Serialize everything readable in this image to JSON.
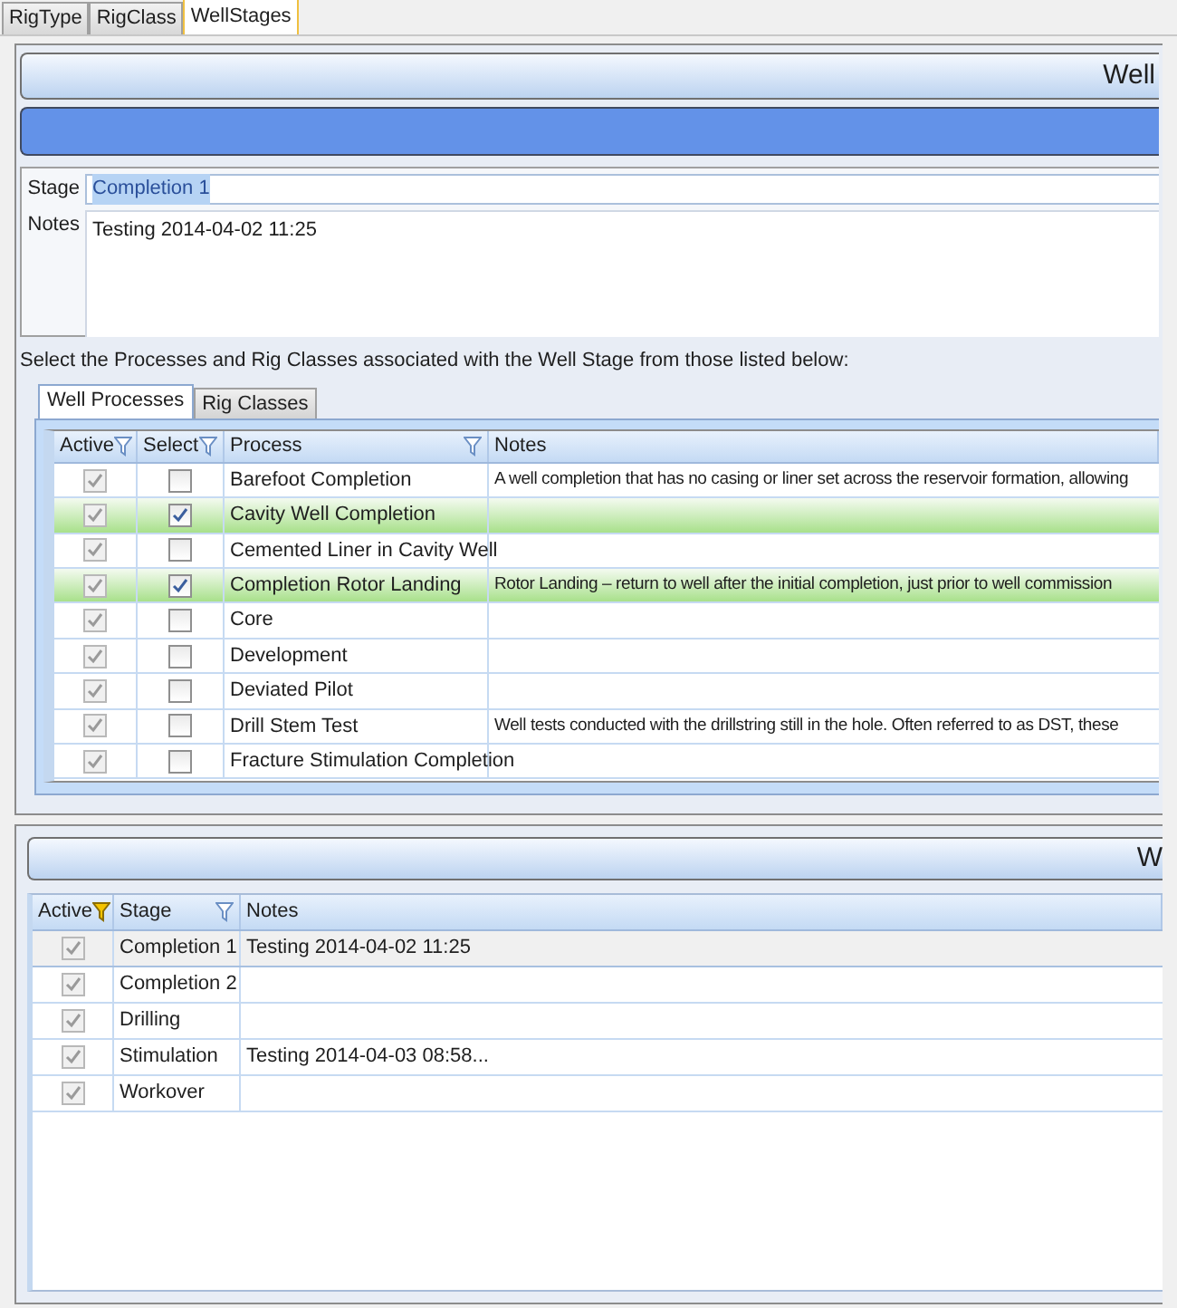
{
  "tabs": [
    {
      "label": "RigType",
      "selected": false
    },
    {
      "label": "RigClass",
      "selected": false
    },
    {
      "label": "WellStages",
      "selected": true
    }
  ],
  "header": {
    "title": "Well"
  },
  "stage_form": {
    "stage_label": "Stage",
    "stage_value": "Completion 1",
    "notes_label": "Notes",
    "notes_value": "Testing 2014-04-02 11:25"
  },
  "instruction": "Select the Processes and Rig Classes associated with the Well Stage from those listed below:",
  "inner_tabs": [
    {
      "label": "Well Processes",
      "selected": true
    },
    {
      "label": "Rig Classes",
      "selected": false
    }
  ],
  "process_grid": {
    "columns": [
      {
        "label": "Active",
        "filtered": false
      },
      {
        "label": "Select",
        "filtered": false
      },
      {
        "label": "Process",
        "filtered": false
      },
      {
        "label": "Notes"
      }
    ],
    "rows": [
      {
        "active": true,
        "select": false,
        "process": "Barefoot Completion",
        "notes": "A well completion that has no casing or liner set across the reservoir formation, allowing"
      },
      {
        "active": true,
        "select": true,
        "process": "Cavity Well Completion"
      },
      {
        "active": true,
        "select": false,
        "process": "Cemented Liner in Cavity Well"
      },
      {
        "active": true,
        "select": true,
        "process": "Completion Rotor Landing",
        "notes": "Rotor Landing – return to well after the initial completion, just prior to well commission"
      },
      {
        "active": true,
        "select": false,
        "process": "Core"
      },
      {
        "active": true,
        "select": false,
        "process": "Development"
      },
      {
        "active": true,
        "select": false,
        "process": "Deviated Pilot"
      },
      {
        "active": true,
        "select": false,
        "process": "Drill Stem Test",
        "notes": "Well tests conducted with the drillstring still in the hole. Often referred to as DST, these"
      },
      {
        "active": true,
        "select": false,
        "process": "Fracture Stimulation Completion"
      }
    ]
  },
  "stages_panel": {
    "title": "W"
  },
  "stage_grid": {
    "columns": [
      {
        "label": "Active",
        "filtered": true
      },
      {
        "label": "Stage",
        "filtered": false
      },
      {
        "label": "Notes"
      }
    ],
    "rows": [
      {
        "active": true,
        "stage": "Completion 1",
        "notes": "Testing 2014-04-02 11:25",
        "selected": true
      },
      {
        "active": true,
        "stage": "Completion 2",
        "selected": false
      },
      {
        "active": true,
        "stage": "Drilling",
        "selected": false
      },
      {
        "active": true,
        "stage": "Stimulation",
        "notes": "Testing 2014-04-03 08:58...",
        "selected": false
      },
      {
        "active": true,
        "stage": "Workover",
        "selected": false
      }
    ]
  }
}
